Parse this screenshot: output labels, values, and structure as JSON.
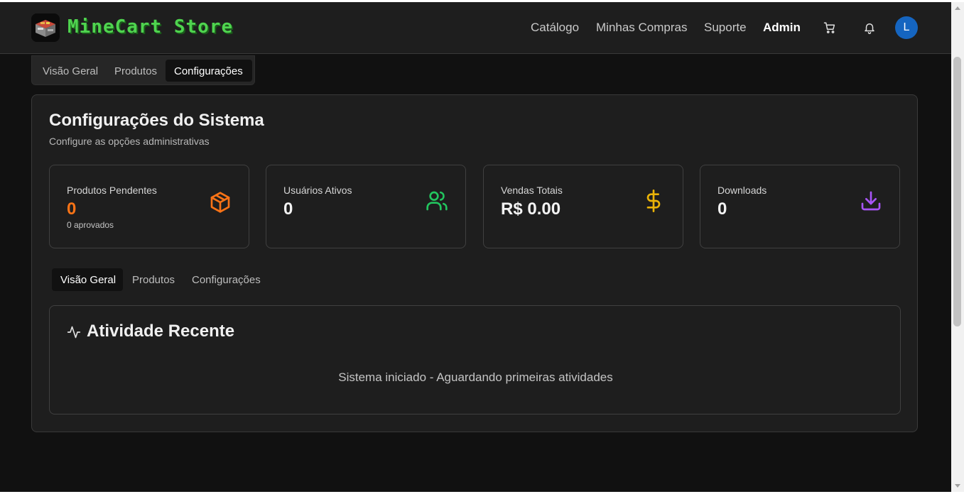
{
  "header": {
    "brand": "MineCart Store",
    "nav": [
      "Catálogo",
      "Minhas Compras",
      "Suporte",
      "Admin"
    ],
    "avatar_initial": "L",
    "icons": [
      "cart-icon",
      "bell-icon"
    ]
  },
  "top_tabs": [
    "Visão Geral",
    "Produtos",
    "Configurações"
  ],
  "panel": {
    "title": "Configurações do Sistema",
    "subtitle": "Configure as opções administrativas"
  },
  "stats": [
    {
      "label": "Produtos Pendentes",
      "value": "0",
      "note": "0 aprovados",
      "icon": "box-icon",
      "color": "#f97316"
    },
    {
      "label": "Usuários Ativos",
      "value": "0",
      "icon": "users-icon",
      "color": "#22c55e"
    },
    {
      "label": "Vendas Totais",
      "value": "R$ 0.00",
      "icon": "dollar-icon",
      "color": "#eab308"
    },
    {
      "label": "Downloads",
      "value": "0",
      "icon": "download-icon",
      "color": "#a855f7"
    }
  ],
  "inner_tabs": [
    "Visão Geral",
    "Produtos",
    "Configurações"
  ],
  "activity": {
    "title": "Atividade Recente",
    "message": "Sistema iniciado - Aguardando primeiras atividades"
  }
}
